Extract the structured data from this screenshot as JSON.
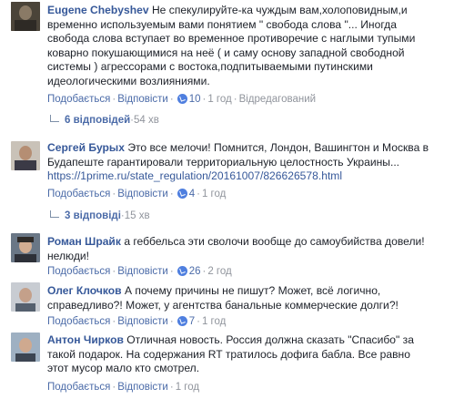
{
  "comments": [
    {
      "author": "Eugene Chebyshev",
      "text": "Не спекулируйте-ка чуждым вам,холоповидным,и временно используемым вами понятием \" свобода слова \"... Иногда свобода слова вступает во временное противоречие с наглыми тупыми коварно покушающимися на неё ( и саму основу западной свободной системы ) агрессорами с востока,подпитываемыми путинскими идеологическими возлияниями.",
      "like_label": "Подобається",
      "reply_label": "Відповісти",
      "likes": "10",
      "time": "1 год",
      "edited": "Відредагований",
      "replies": "6 відповідей",
      "replies_time": "54 хв"
    },
    {
      "author": "Сергей Бурых",
      "text": "Это все мелочи! Помнится, Лондон, Вашингтон и Москва в Будапеште гарантировали территориальную целостность Украины...",
      "link": "https://1prime.ru/state_regulation/20161007/826626578.html",
      "like_label": "Подобається",
      "reply_label": "Відповісти",
      "likes": "4",
      "time": "1 год",
      "replies": "3 відповіді",
      "replies_time": "15 хв"
    },
    {
      "author": "Роман Шрайк",
      "text": "а геббельса эти сволочи вообще до самоубийства довели! нелюди!",
      "like_label": "Подобається",
      "reply_label": "Відповісти",
      "likes": "26",
      "time": "2 год"
    },
    {
      "author": "Олег Клочков",
      "text": "А почему причины не пишут? Может, всё логично, справедливо?! Может, у агентства банальные коммерческие долги?!",
      "like_label": "Подобається",
      "reply_label": "Відповісти",
      "likes": "7",
      "time": "1 год"
    },
    {
      "author": "Антон Чирков",
      "text": "Отличная новость. Россия должна сказать \"Спасибо\" за такой подарок. На содержания RT тратилось дофига бабла. Все равно этот мусор мало кто смотрел.",
      "like_label": "Подобається",
      "reply_label": "Відповісти",
      "time": "1 год"
    }
  ]
}
